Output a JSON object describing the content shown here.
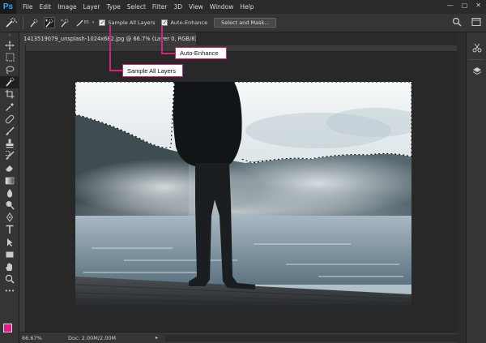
{
  "app": {
    "logo": "Ps",
    "menu": [
      "File",
      "Edit",
      "Image",
      "Layer",
      "Type",
      "Select",
      "Filter",
      "3D",
      "View",
      "Window",
      "Help"
    ],
    "window_controls": [
      "—",
      "▢",
      "✕"
    ]
  },
  "options_bar": {
    "brush_size": "85",
    "sample_all_layers_label": "Sample All Layers",
    "sample_all_layers_checked": "✓",
    "auto_enhance_label": "Auto-Enhance",
    "auto_enhance_checked": "✓",
    "refine_button": "Select and Mask..."
  },
  "document": {
    "tab_title": "1413519079_unsplash-1024x682.jpg @ 66.7% (Layer 0, RGB/8) *"
  },
  "status": {
    "zoom": "66.67%",
    "doc_size": "Doc: 2.00M/2.00M"
  },
  "callouts": {
    "sample_all_layers": "Sample All Layers",
    "auto_enhance": "Auto-Enhance"
  },
  "colors": {
    "foreground": "#e9178a",
    "background": "#ffffff",
    "callout_border": "#d4237a",
    "ps_blue": "#31a8ff"
  }
}
